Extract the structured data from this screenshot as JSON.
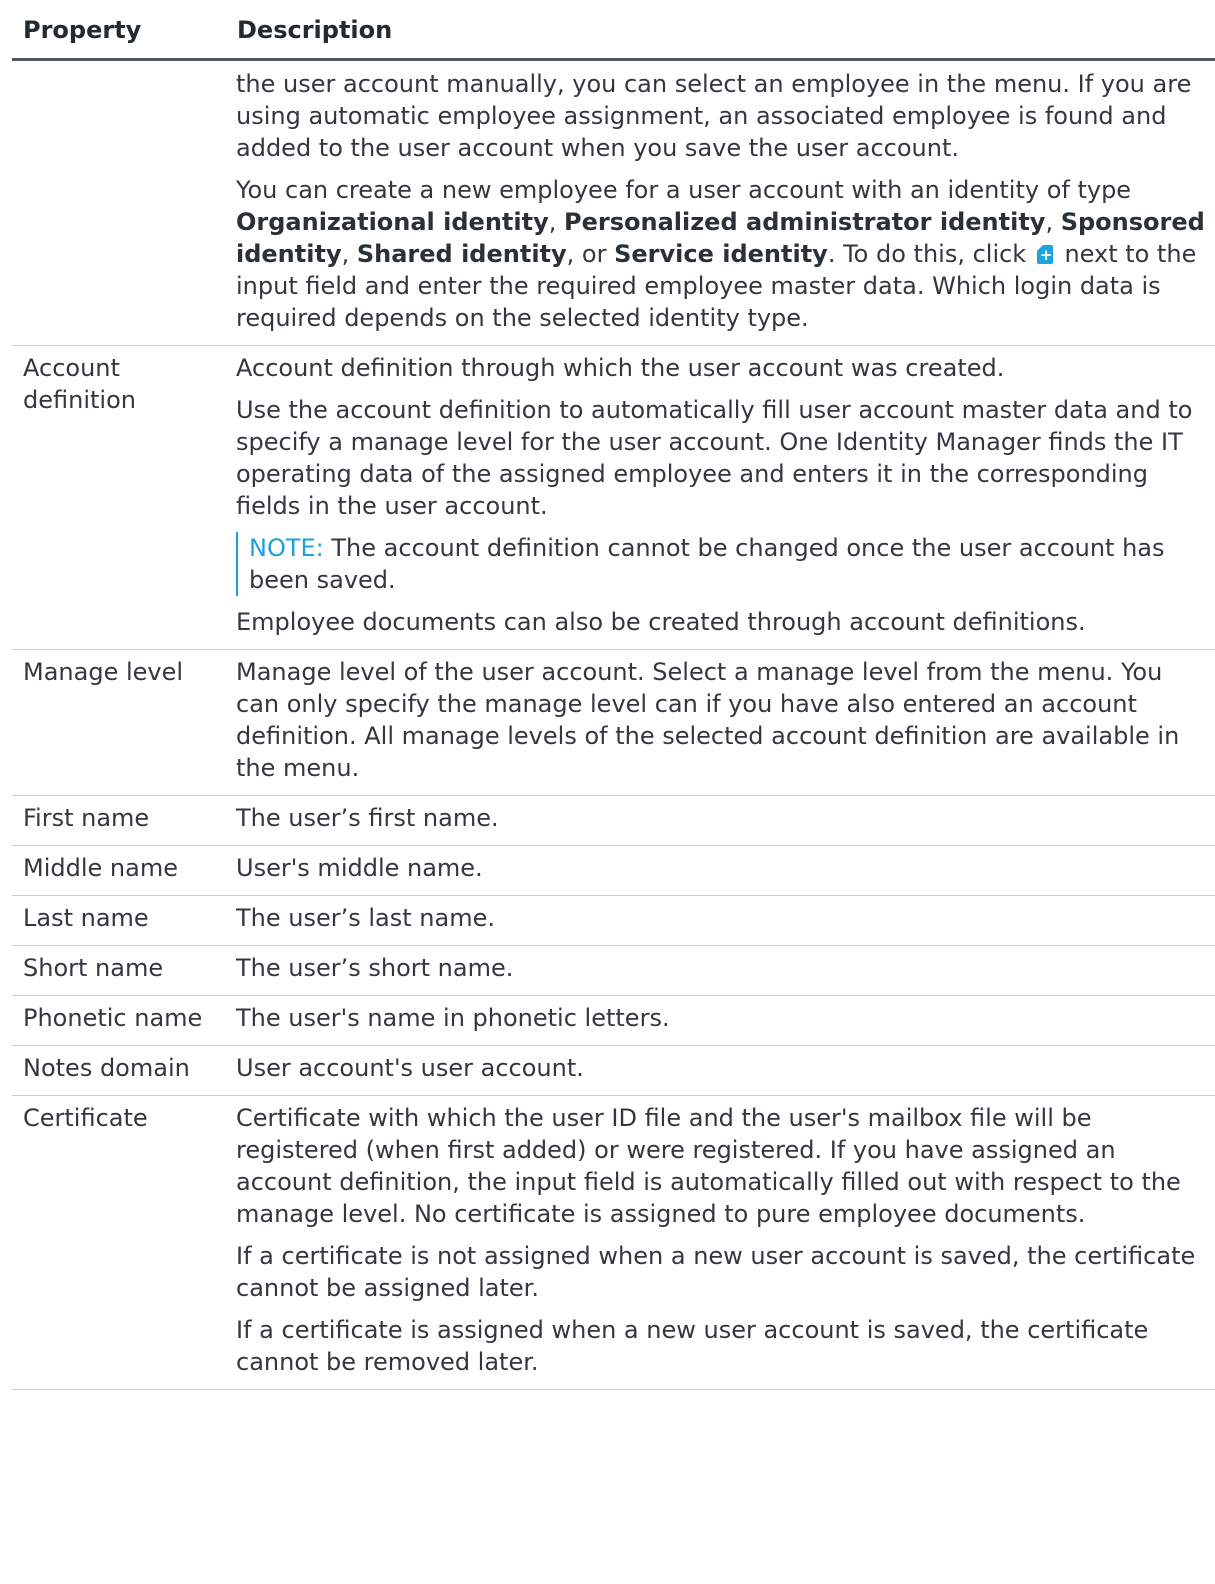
{
  "table": {
    "headers": {
      "property": "Property",
      "description": "Description"
    },
    "rows": [
      {
        "property": "",
        "paragraphs": [
          "the user account manually, you can select an employee in the menu. If you are using automatic employee assignment, an associated employee is found and added to the user account when you save the user account."
        ],
        "create_employee": {
          "t1": "You can create a new employee for a user account with an identity of type ",
          "b1": "Organizational identity",
          "t2": ", ",
          "b2": "Personalized administrator identity",
          "t3": ", ",
          "b3": "Sponsored identity",
          "t4": ", ",
          "b4": "Shared identity",
          "t5": ", or ",
          "b5": "Service identity",
          "t6": ". To do this, click ",
          "icon": "add-document-icon",
          "t7": " next to the input field and enter the required employee master data. Which login data is required depends on the selected identity type."
        }
      },
      {
        "property": "Account definition",
        "paragraphs": [
          "Account definition through which the user account was created.",
          "Use the account definition to automatically fill user account master data and to specify a manage level for the user account. One Identity Manager finds the IT operating data of the assigned employee and enters it in the corresponding fields in the user account."
        ],
        "note": {
          "label": "NOTE:",
          "text": " The account definition cannot be changed once the user account has been saved."
        },
        "after_note": "Employee documents can also be created through account definitions."
      },
      {
        "property": "Manage level",
        "paragraphs": [
          "Manage level of the user account. Select a manage level from the menu. You can only specify the manage level can if you have also entered an account definition. All manage levels of the selected account definition are available in the menu."
        ]
      },
      {
        "property": "First name",
        "paragraphs": [
          "The user’s first name."
        ]
      },
      {
        "property": "Middle name",
        "paragraphs": [
          "User's middle name."
        ]
      },
      {
        "property": "Last name",
        "paragraphs": [
          "The user’s last name."
        ]
      },
      {
        "property": "Short name",
        "paragraphs": [
          "The user’s short name."
        ]
      },
      {
        "property": "Phonetic name",
        "paragraphs": [
          "The user's name in phonetic letters."
        ]
      },
      {
        "property": "Notes domain",
        "paragraphs": [
          "User account's user account."
        ]
      },
      {
        "property": "Certificate",
        "paragraphs": [
          "Certificate with which the user ID file and the user's mailbox file will be registered (when first added) or were registered. If you have assigned an account definition, the input field is automatically filled out with respect to the manage level. No certificate is assigned to pure employee documents.",
          "If a certificate is not assigned when a new user account is saved, the certificate cannot be assigned later.",
          "If a certificate is assigned when a new user account is saved, the certificate cannot be removed later."
        ]
      }
    ]
  },
  "colors": {
    "note_accent": "#1ea0dd",
    "icon_blue": "#1ea3db",
    "header_rule": "#52585f",
    "row_rule": "#c9cbcf"
  }
}
